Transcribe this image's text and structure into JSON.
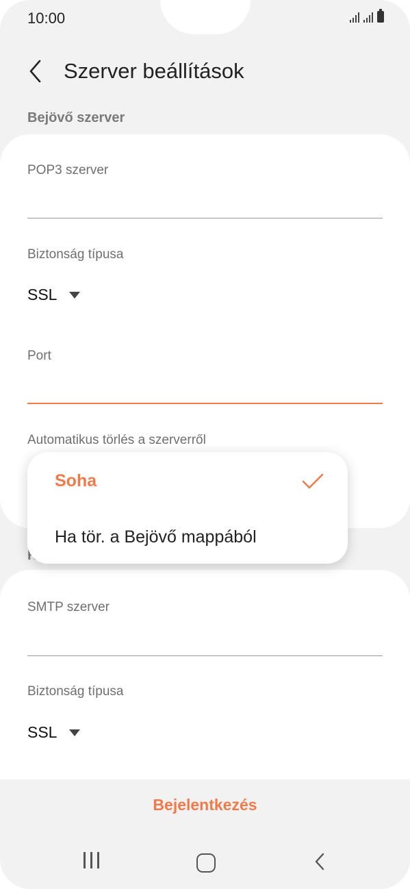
{
  "status_bar": {
    "time": "10:00"
  },
  "header": {
    "title": "Szerver beállítások"
  },
  "incoming": {
    "section_title": "Bejövő szerver",
    "pop3_label": "POP3 szerver",
    "pop3_value": "",
    "security_label": "Biztonság típusa",
    "security_value": "SSL",
    "port_label": "Port",
    "port_value": "",
    "auto_delete_label": "Automatikus törlés a szerverről"
  },
  "outgoing": {
    "section_title_visible": "K",
    "smtp_label": "SMTP szerver",
    "smtp_value": "",
    "security_label": "Biztonság típusa",
    "security_value": "SSL"
  },
  "popup": {
    "options": [
      {
        "label": "Soha",
        "selected": true
      },
      {
        "label": "Ha tör. a Bejövő mappából",
        "selected": false
      }
    ]
  },
  "bottom": {
    "login_label": "Bejelentkezés"
  },
  "colors": {
    "accent": "#f07a4a",
    "background": "#f2f2f2",
    "card": "#ffffff"
  },
  "icons": [
    "back-chevron-icon",
    "signal-icon",
    "battery-icon",
    "dropdown-caret-icon",
    "check-icon",
    "recent-apps-icon",
    "home-icon",
    "nav-back-icon"
  ]
}
